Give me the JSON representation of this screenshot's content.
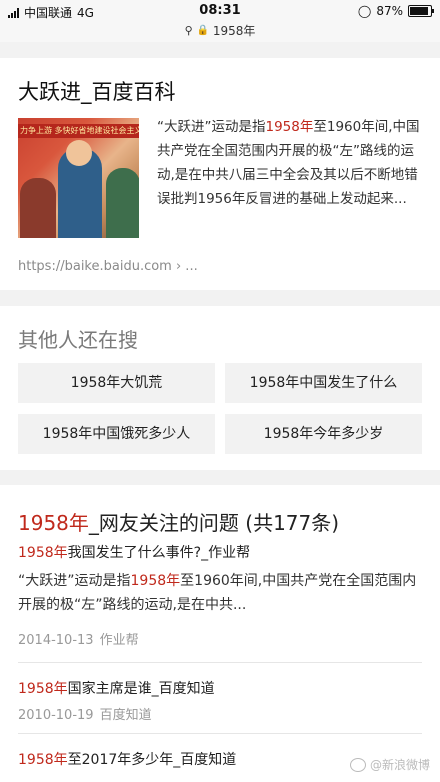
{
  "status": {
    "carrier": "中国联通",
    "network": "4G",
    "time": "08:31",
    "battery": "87%",
    "battery_level": 0.87
  },
  "url": {
    "text": "1958年"
  },
  "result1": {
    "title": "大跃进_百度百科",
    "image_banner": "力争上游 多快好省地建设社会主义",
    "snippet_pre": "“大跃进”运动是指",
    "snippet_hl": "1958年",
    "snippet_post": "至1960年间,中国共产党在全国范围内开展的极“左”路线的运动,是在中共八届三中全会及其以后不断地错误批判1956年反冒进的基础上发动起来...",
    "source": "https://baike.baidu.com › ..."
  },
  "related": {
    "title": "其他人还在搜",
    "chips": [
      "1958年大饥荒",
      "1958年中国发生了什么",
      "1958年中国饿死多少人",
      "1958年今年多少岁"
    ]
  },
  "qa": {
    "title_hl": "1958年",
    "title_rest": "_网友关注的问题 (共177条)",
    "q1_hl": "1958年",
    "q1_rest": "我国发生了什么事件?_作业帮",
    "q1_snip_pre": "“大跃进”运动是指",
    "q1_snip_hl": "1958年",
    "q1_snip_post": "至1960年间,中国共产党在全国范围内开展的极“左”路线的运动,是在中共...",
    "q1_date": "2014-10-13",
    "q1_source": "作业帮",
    "q2_hl": "1958年",
    "q2_rest": "国家主席是谁_百度知道",
    "q2_date": "2010-10-19",
    "q2_source": "百度知道",
    "q3_hl": "1958年",
    "q3_rest": "至2017年多少年_百度知道"
  },
  "watermark": "@新浪微博"
}
